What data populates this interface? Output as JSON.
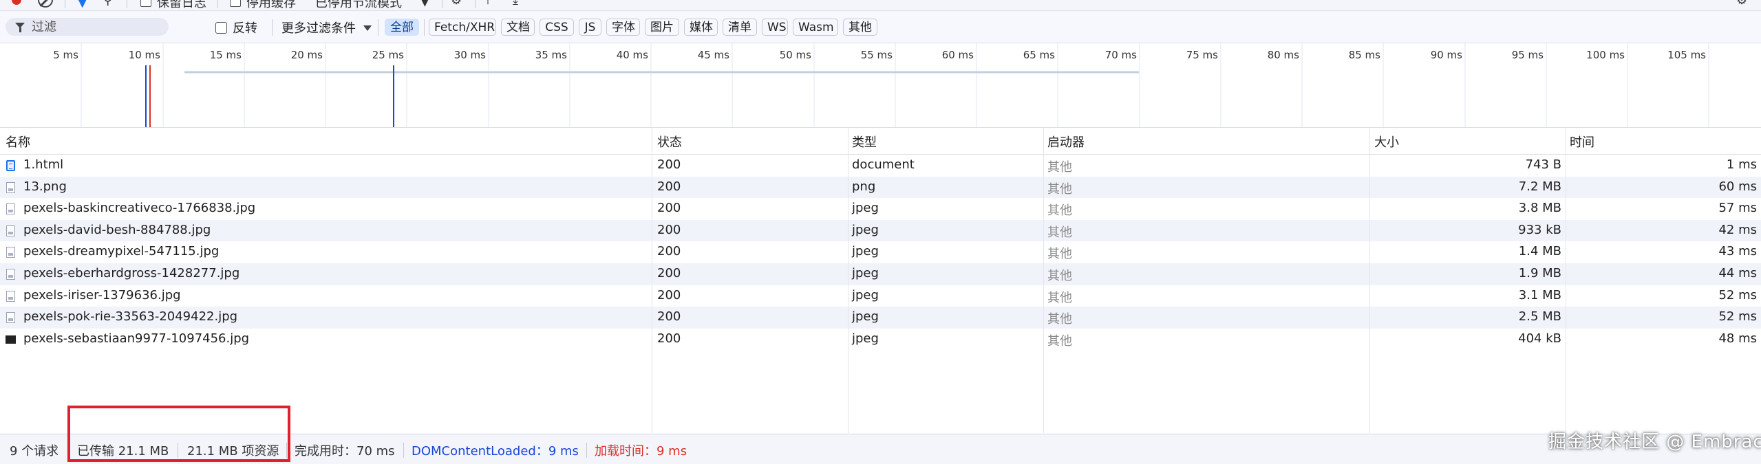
{
  "toolbar": {
    "preserve_log_label": "保留日志",
    "disable_cache_label": "停用缓存",
    "throttling_label": "已停用节流模式"
  },
  "filter_bar": {
    "filter_placeholder": "过滤",
    "invert_label": "反转",
    "more_filters_label": "更多过滤条件",
    "type_filters": [
      "全部",
      "Fetch/XHR",
      "文档",
      "CSS",
      "JS",
      "字体",
      "图片",
      "媒体",
      "清单",
      "WS",
      "Wasm",
      "其他"
    ],
    "active_filter": "全部"
  },
  "timeline": {
    "tick_labels": [
      "5 ms",
      "10 ms",
      "15 ms",
      "20 ms",
      "25 ms",
      "30 ms",
      "35 ms",
      "40 ms",
      "45 ms",
      "50 ms",
      "55 ms",
      "60 ms",
      "65 ms",
      "70 ms",
      "75 ms",
      "80 ms",
      "85 ms",
      "90 ms",
      "95 ms",
      "100 ms",
      "105 ms"
    ],
    "colors": {
      "dom_content_loaded": "#1a46d6",
      "load": "#d93025",
      "bar": "#c5cde0",
      "gridline": "#dfe6f2"
    }
  },
  "table": {
    "columns": {
      "name": "名称",
      "status": "状态",
      "type": "类型",
      "initiator": "启动器",
      "size": "大小",
      "time": "时间"
    },
    "rows": [
      {
        "icon": "document-icon",
        "name": "1.html",
        "status": "200",
        "type": "document",
        "initiator": "其他",
        "size": "743 B",
        "time": "1 ms"
      },
      {
        "icon": "image-icon",
        "name": "13.png",
        "status": "200",
        "type": "png",
        "initiator": "其他",
        "size": "7.2 MB",
        "time": "60 ms"
      },
      {
        "icon": "image-icon",
        "name": "pexels-baskincreativeco-1766838.jpg",
        "status": "200",
        "type": "jpeg",
        "initiator": "其他",
        "size": "3.8 MB",
        "time": "57 ms"
      },
      {
        "icon": "image-icon",
        "name": "pexels-david-besh-884788.jpg",
        "status": "200",
        "type": "jpeg",
        "initiator": "其他",
        "size": "933 kB",
        "time": "42 ms"
      },
      {
        "icon": "image-icon",
        "name": "pexels-dreamypixel-547115.jpg",
        "status": "200",
        "type": "jpeg",
        "initiator": "其他",
        "size": "1.4 MB",
        "time": "43 ms"
      },
      {
        "icon": "image-icon",
        "name": "pexels-eberhardgross-1428277.jpg",
        "status": "200",
        "type": "jpeg",
        "initiator": "其他",
        "size": "1.9 MB",
        "time": "44 ms"
      },
      {
        "icon": "image-icon",
        "name": "pexels-iriser-1379636.jpg",
        "status": "200",
        "type": "jpeg",
        "initiator": "其他",
        "size": "3.1 MB",
        "time": "52 ms"
      },
      {
        "icon": "image-icon",
        "name": "pexels-pok-rie-33563-2049422.jpg",
        "status": "200",
        "type": "jpeg",
        "initiator": "其他",
        "size": "2.5 MB",
        "time": "52 ms"
      },
      {
        "icon": "image-dark-icon",
        "name": "pexels-sebastiaan9977-1097456.jpg",
        "status": "200",
        "type": "jpeg",
        "initiator": "其他",
        "size": "404 kB",
        "time": "48 ms"
      }
    ]
  },
  "status_bar": {
    "requests": "9 个请求",
    "transferred": "已传输 21.1 MB",
    "resources": "21.1 MB 项资源",
    "finish": "完成用时：70 ms",
    "dom_content_loaded": "DOMContentLoaded：9 ms",
    "load": "加载时间：9 ms",
    "colors": {
      "dcl": "#1a46d6",
      "load": "#d93025"
    }
  },
  "watermark": "掘金技术社区 @ Embrace"
}
